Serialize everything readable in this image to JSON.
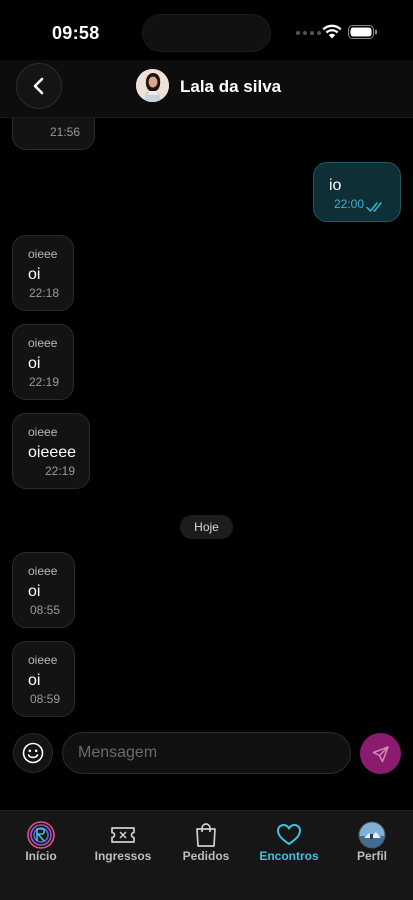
{
  "status_bar": {
    "time": "09:58"
  },
  "header": {
    "contact_name": "Lala da silva"
  },
  "messages": [
    {
      "direction": "in",
      "sender": "",
      "text": "",
      "time": "21:56"
    },
    {
      "direction": "out",
      "text": "io",
      "time": "22:00",
      "read": true
    },
    {
      "direction": "in",
      "sender": "oieee",
      "text": "oi",
      "time": "22:18"
    },
    {
      "direction": "in",
      "sender": "oieee",
      "text": "oi",
      "time": "22:19"
    },
    {
      "direction": "in",
      "sender": "oieee",
      "text": "oieeee",
      "time": "22:19"
    },
    {
      "direction": "in",
      "sender": "oieee",
      "text": "oi",
      "time": "08:55"
    },
    {
      "direction": "in",
      "sender": "oieee",
      "text": "oi",
      "time": "08:59"
    }
  ],
  "day_separator": "Hoje",
  "composer": {
    "placeholder": "Mensagem",
    "value": ""
  },
  "tabs": [
    {
      "label": "Início",
      "icon": "logo-icon",
      "active": false
    },
    {
      "label": "Ingressos",
      "icon": "ticket-icon",
      "active": false
    },
    {
      "label": "Pedidos",
      "icon": "shopping-bag-icon",
      "active": false
    },
    {
      "label": "Encontros",
      "icon": "heart-icon",
      "active": true
    },
    {
      "label": "Perfil",
      "icon": "profile-avatar",
      "active": false
    }
  ],
  "colors": {
    "accent": "#3fc1dd",
    "send_button": "#8a1b6f",
    "outgoing_bubble": "#0f2f36"
  }
}
